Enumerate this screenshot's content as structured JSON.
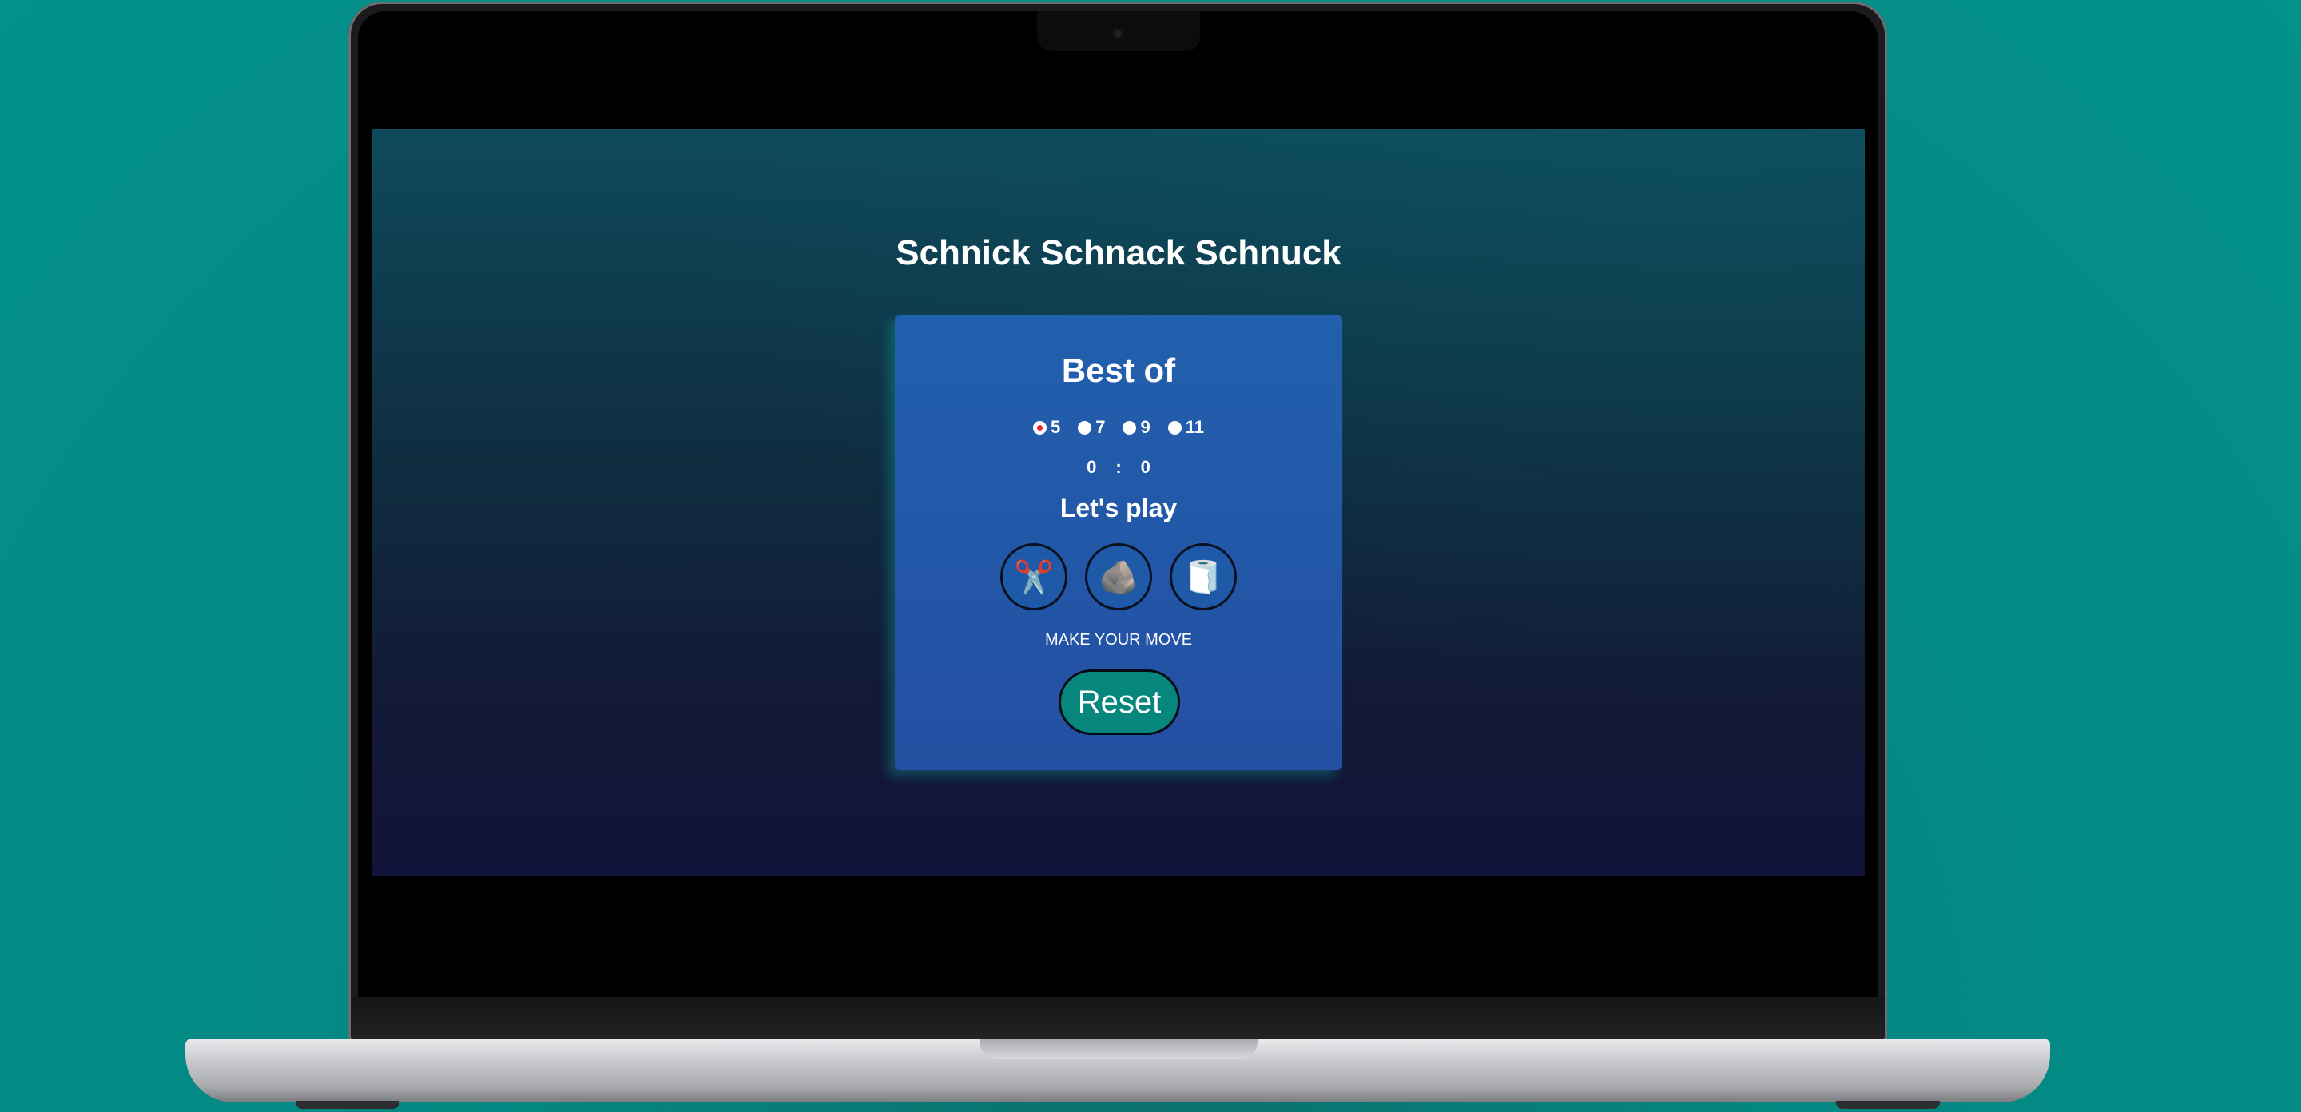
{
  "page": {
    "title": "Schnick Schnack Schnuck"
  },
  "game": {
    "heading": "Best of",
    "round_options": [
      {
        "label": "5",
        "checked": true
      },
      {
        "label": "7",
        "checked": false
      },
      {
        "label": "9",
        "checked": false
      },
      {
        "label": "11",
        "checked": false
      }
    ],
    "score": {
      "player": "0",
      "separator": ":",
      "computer": "0"
    },
    "prompt": "Let's play",
    "moves": [
      {
        "icon": "scissors-icon",
        "glyph": "✂️"
      },
      {
        "icon": "rock-icon",
        "glyph": "🪨"
      },
      {
        "icon": "paper-icon",
        "glyph": "🧻"
      }
    ],
    "status": "MAKE YOUR MOVE",
    "reset_label": "Reset"
  },
  "colors": {
    "background": "#038a86",
    "card": "#2160ad",
    "reset_button": "#07867e",
    "radio_selected": "#e32b3a"
  }
}
